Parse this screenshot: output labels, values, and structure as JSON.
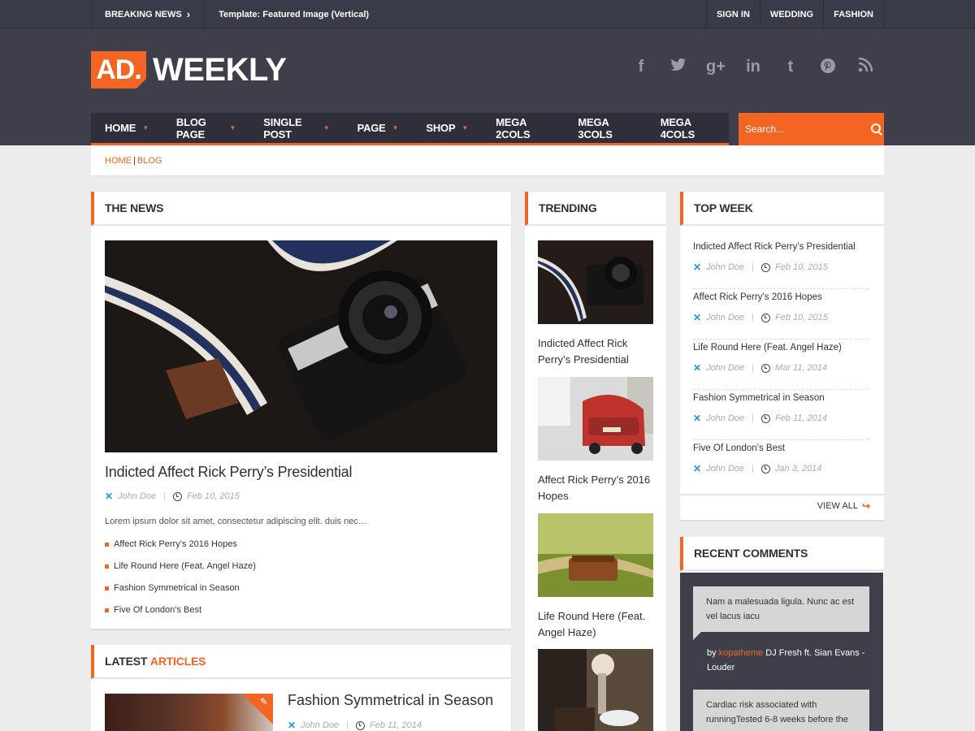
{
  "topbar": {
    "breaking_label": "BREAKING NEWS",
    "ticker": "Template: Featured Image (Vertical)",
    "links": [
      "SIGN IN",
      "WEDDING",
      "FASHION"
    ]
  },
  "logo": {
    "box": "AD.",
    "text": "WEEKLY"
  },
  "social": [
    {
      "icon": "facebook-icon",
      "glyph": "f"
    },
    {
      "icon": "twitter-icon",
      "glyph": "🐦"
    },
    {
      "icon": "google-plus-icon",
      "glyph": "g+"
    },
    {
      "icon": "linkedin-icon",
      "glyph": "in"
    },
    {
      "icon": "tumblr-icon",
      "glyph": "t"
    },
    {
      "icon": "pinterest-icon",
      "glyph": "℗"
    },
    {
      "icon": "rss-icon",
      "glyph": "◝"
    }
  ],
  "nav": {
    "items": [
      {
        "label": "HOME",
        "caret": true
      },
      {
        "label": "BLOG PAGE",
        "caret": true
      },
      {
        "label": "SINGLE POST",
        "caret": true
      },
      {
        "label": "PAGE",
        "caret": true
      },
      {
        "label": "SHOP",
        "caret": true
      },
      {
        "label": "MEGA 2COLS",
        "caret": false
      },
      {
        "label": "MEGA 3COLS",
        "caret": false
      },
      {
        "label": "MEGA 4COLS",
        "caret": false
      }
    ],
    "search_placeholder": "Search..."
  },
  "breadcrumb": {
    "home": "HOME",
    "sep": "|",
    "current": "BLOG"
  },
  "the_news": {
    "heading": "THE NEWS",
    "title": "Indicted Affect Rick Perry’s Presidential",
    "author": "John Doe",
    "date": "Feb 10, 2015",
    "excerpt": "Lorem ipsum dolor sit amet, consectetur adipiscing elit. duis nec…",
    "list": [
      "Affect Rick Perry’s 2016 Hopes",
      "Life Round Here (Feat. Angel Haze)",
      "Fashion Symmetrical in Season",
      "Five Of London’s Best"
    ]
  },
  "trending": {
    "heading": "TRENDING",
    "items": [
      "Indicted Affect Rick Perry’s Presidential",
      "Affect Rick Perry’s 2016 Hopes",
      "Life Round Here (Feat. Angel Haze)"
    ]
  },
  "top_week": {
    "heading": "TOP WEEK",
    "items": [
      {
        "title": "Indicted Affect Rick Perry’s Presidential",
        "author": "John Doe",
        "date": "Feb 10, 2015"
      },
      {
        "title": "Affect Rick Perry’s 2016 Hopes",
        "author": "John Doe",
        "date": "Feb 10, 2015"
      },
      {
        "title": "Life Round Here (Feat. Angel Haze)",
        "author": "John Doe",
        "date": "Mar 11, 2014"
      },
      {
        "title": "Fashion Symmetrical in Season",
        "author": "John Doe",
        "date": "Feb 11, 2014"
      },
      {
        "title": "Five Of London’s Best",
        "author": "John Doe",
        "date": "Jan 3, 2014"
      }
    ],
    "view_all": "VIEW ALL"
  },
  "recent_comments": {
    "heading": "RECENT COMMENTS",
    "items": [
      {
        "text": "Nam a malesuada ligula. Nunc ac est vel lacus iacu",
        "by": "by",
        "user": "kopatheme",
        "post": "DJ Fresh ft. Sian Evans - Louder"
      },
      {
        "text": "Cardiac risk associated with runningTested 6-8 weeks before the"
      }
    ]
  },
  "latest_articles": {
    "heading_a": "LATEST",
    "heading_b": "ARTICLES",
    "title": "Fashion Symmetrical in Season",
    "author": "John Doe",
    "date": "Feb 11, 2014"
  },
  "colors": {
    "accent": "#f26522",
    "header": "#3e3f4b",
    "nav": "#2e2f3a"
  }
}
